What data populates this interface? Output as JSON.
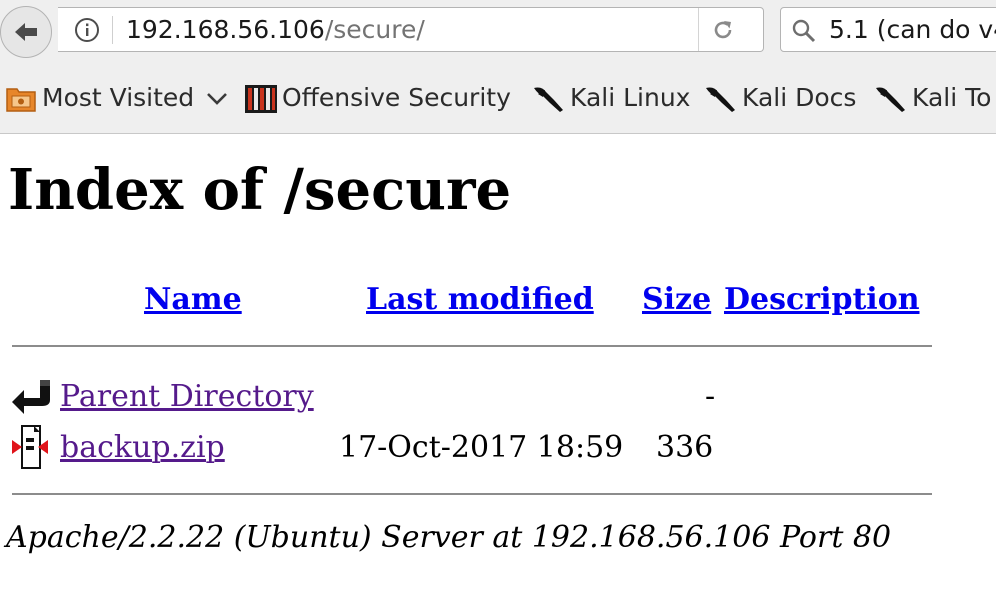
{
  "browser": {
    "url_host": "192.168.56.106",
    "url_path": "/secure/",
    "search_text": "5.1 (can do v4"
  },
  "bookmarks": [
    {
      "label": "Most Visited",
      "icon": "most-visited-icon",
      "has_dropdown": true
    },
    {
      "label": "Offensive Security",
      "icon": "offensive-security-icon"
    },
    {
      "label": "Kali Linux",
      "icon": "kali-dragon-icon"
    },
    {
      "label": "Kali Docs",
      "icon": "kali-dragon-icon"
    },
    {
      "label": "Kali To",
      "icon": "kali-dragon-icon"
    }
  ],
  "page": {
    "title": "Index of /secure",
    "columns": [
      "Name",
      "Last modified",
      "Size",
      "Description"
    ],
    "rows": [
      {
        "icon": "parent-directory-icon",
        "name": "Parent Directory",
        "modified": "",
        "size": "-",
        "description": ""
      },
      {
        "icon": "zip-file-icon",
        "name": "backup.zip",
        "modified": "17-Oct-2017 18:59",
        "size": "336",
        "description": ""
      }
    ],
    "footer": "Apache/2.2.22 (Ubuntu) Server at 192.168.56.106 Port 80"
  },
  "colors": {
    "link": "#0000ee",
    "visited_link": "#551a8b",
    "toolbar_bg": "#efefef"
  }
}
